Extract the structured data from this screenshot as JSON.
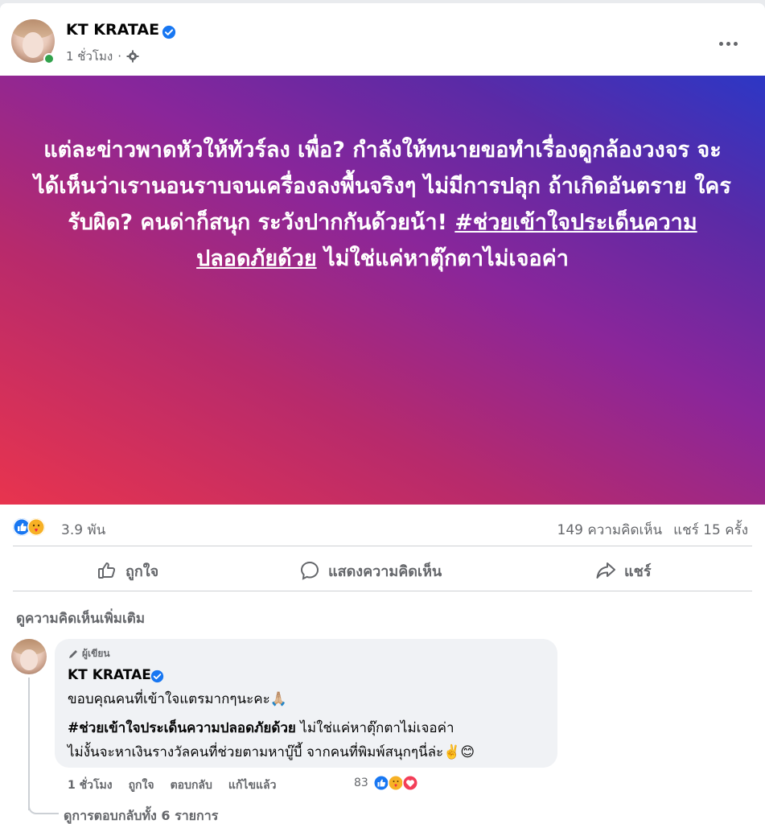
{
  "post": {
    "author": "KT KRATAE",
    "time": "1 ชั่วโมง",
    "separator": "·",
    "icons": [
      "verified-badge-icon",
      "gear-icon",
      "more-options-icon"
    ],
    "text_before_tag": "แต่ละข่าวพาดหัวให้ทัวร์ลง เพื่อ? กำลังให้ทนายขอทำเรื่องดูกล้องวงจร จะได้เห็นว่าเรานอนราบจนเครื่องลงพื้นจริงๆ ไม่มีการปลุก ถ้าเกิดอันตราย ใครรับผิด? คนด่าก็สนุก ระวังปากกันด้วยน้า! ",
    "hashtag": "#ช่วยเข้าใจประเด็นความปลอดภัยด้วย",
    "text_after_tag": " ไม่ใช่แค่หาตุ๊กตาไม่เจอค่า",
    "background_colors": [
      "#e8344e",
      "#8a269a",
      "#2c37c5"
    ]
  },
  "stats": {
    "reactions": "3.9 พัน",
    "comments": "149 ความคิดเห็น",
    "shares": "แชร์ 15 ครั้ง"
  },
  "actions": {
    "like": "ถูกใจ",
    "comment": "แสดงความคิดเห็น",
    "share": "แชร์"
  },
  "view_more": "ดูความคิดเห็นเพิ่มเติม",
  "comment": {
    "badge": "ผู้เขียน",
    "author": "KT KRATAE",
    "line1": "ขอบคุณคนที่เข้าใจแตรมากๆนะคะ🙏🏼",
    "hashtag": "#ช่วยเข้าใจประเด็นความปลอดภัยด้วย",
    "line2_rest": " ไม่ใช่แค่หาตุ๊กตาไม่เจอค่า",
    "line3": "ไม่งั้นจะหาเงินรางวัลคนที่ช่วยตามหาบู๊บี้ จากคนที่พิมพ์สนุกๆนี่ล่ะ✌️😊",
    "time": "1 ชั่วโมง",
    "like": "ถูกใจ",
    "reply": "ตอบกลับ",
    "edited": "แก้ไขแล้ว",
    "reaction_count": "83",
    "view_replies": "ดูการตอบกลับทั้ง 6 รายการ"
  },
  "colors": {
    "like_blue": "#1877f2",
    "meta_gray": "#65676b",
    "online_green": "#31a24c"
  }
}
